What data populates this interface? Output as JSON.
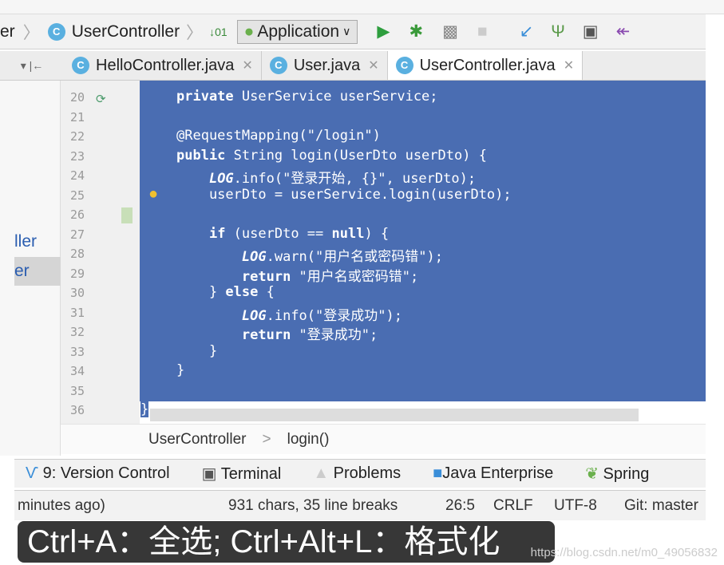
{
  "toolbar": {
    "breadcrumb_prev": "er",
    "breadcrumb_class": "UserController",
    "run_config": "Application",
    "class_icon_letter": "C"
  },
  "tabs": [
    {
      "label": "HelloController.java",
      "active": false
    },
    {
      "label": "User.java",
      "active": false
    },
    {
      "label": "UserController.java",
      "active": true
    }
  ],
  "sidebar": {
    "items": [
      {
        "label": "ller"
      },
      {
        "label": "er",
        "selected": true
      }
    ]
  },
  "editor": {
    "line_numbers": [
      "20",
      "21",
      "22",
      "23",
      "24",
      "25",
      "26",
      "27",
      "28",
      "29",
      "30",
      "31",
      "32",
      "33",
      "34",
      "35",
      "36"
    ],
    "lines": [
      "private UserService userService;",
      "",
      "@RequestMapping(\"/login\")",
      "public String login(UserDto userDto) {",
      "    LOG.info(\"登录开始, {}\", userDto);",
      "    userDto = userService.login(userDto);",
      "",
      "    if (userDto == null) {",
      "        LOG.warn(\"用户名或密码错\");",
      "        return \"用户名或密码错\";",
      "    } else {",
      "        LOG.info(\"登录成功\");",
      "        return \"登录成功\";",
      "    }",
      "}",
      "",
      "}"
    ],
    "selection_color": "#4a6db2"
  },
  "breadcrumb": {
    "items": [
      "UserController",
      "login()"
    ],
    "separator": ">"
  },
  "tool_windows": [
    {
      "label": "9: Version Control",
      "icon": "version-control-icon"
    },
    {
      "label": "Terminal",
      "icon": "terminal-icon"
    },
    {
      "label": "Problems",
      "icon": "warning-icon"
    },
    {
      "label": "Java Enterprise",
      "icon": "java-enterprise-icon"
    },
    {
      "label": "Spring",
      "icon": "spring-leaf-icon"
    }
  ],
  "status": {
    "vcs": "minutes ago)",
    "selection": "931 chars, 35 line breaks",
    "position": "26:5",
    "line_sep": "CRLF",
    "encoding": "UTF-8",
    "branch": "Git: master"
  },
  "subtitle": "Ctrl+A：全选; Ctrl+Alt+L：格式化",
  "watermark": "https://blog.csdn.net/m0_49056832"
}
